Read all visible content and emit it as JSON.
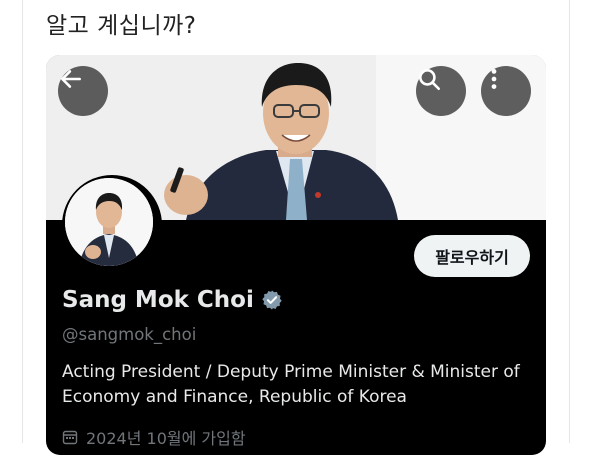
{
  "page": {
    "question_text": "알고 계십니까?"
  },
  "profile": {
    "display_name": "Sang Mok Choi",
    "handle": "@sangmok_choi",
    "bio": "Acting President / Deputy Prime Minister & Minister of Economy and Finance,  Republic of Korea",
    "joined": "2024년 10월에 가입함"
  },
  "buttons": {
    "follow_label": "팔로우하기"
  },
  "icons": {
    "back": "back-arrow-icon",
    "search": "search-icon",
    "more": "more-options-icon",
    "verified": "verified-badge-icon",
    "calendar": "calendar-icon"
  },
  "colors": {
    "card_background": "#000000",
    "primary_text": "#e7e9ea",
    "secondary_text": "#71767b",
    "follow_button_bg": "#eff3f4",
    "verified_badge": "#829aab"
  }
}
